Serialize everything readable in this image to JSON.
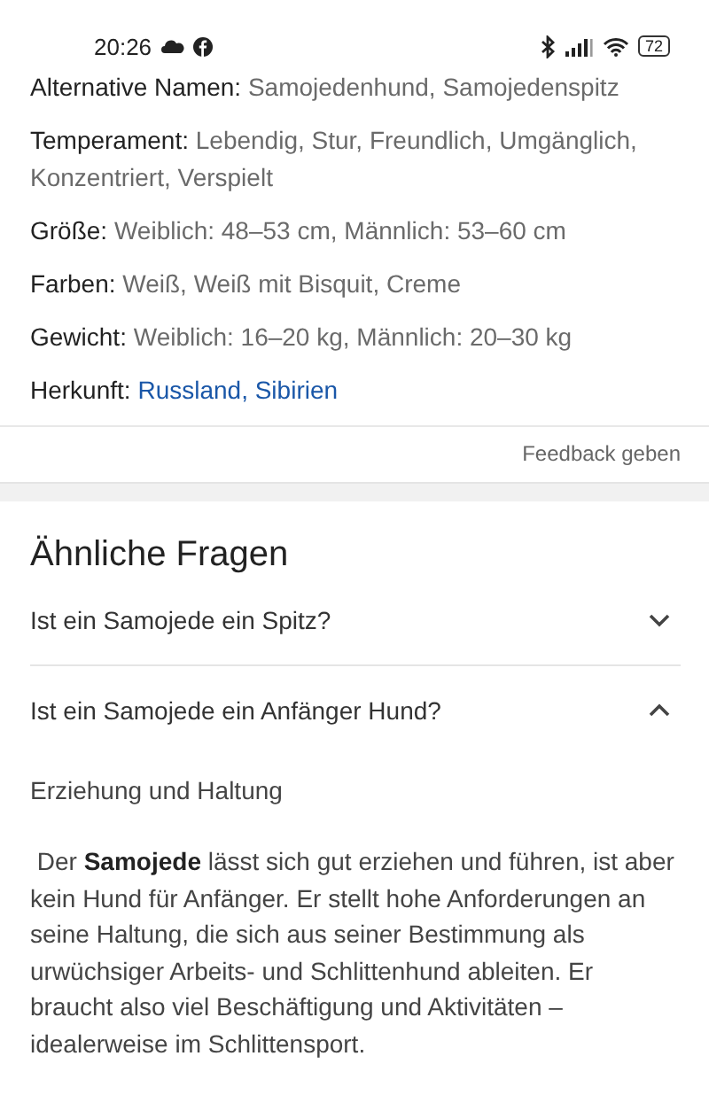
{
  "status_bar": {
    "time": "20:26",
    "battery": "72"
  },
  "facts": [
    {
      "label": "Alternative Namen:",
      "value": "Samojedenhund, Samojedenspitz",
      "kind": "text"
    },
    {
      "label": "Temperament:",
      "value": "Lebendig, Stur, Freundlich, Umgänglich, Konzentriert, Verspielt",
      "kind": "text"
    },
    {
      "label": "Größe:",
      "value": "Weiblich: 48–53 cm, Männlich: 53–60 cm",
      "kind": "text"
    },
    {
      "label": "Farben:",
      "value": "Weiß, Weiß mit Bisquit, Creme",
      "kind": "text"
    },
    {
      "label": "Gewicht:",
      "value": "Weiblich: 16–20 kg, Männlich: 20–30 kg",
      "kind": "text"
    },
    {
      "label": "Herkunft:",
      "value": "Russland, Sibirien",
      "kind": "link"
    }
  ],
  "feedback": "Feedback geben",
  "related": {
    "title": "Ähnliche Fragen",
    "questions": [
      {
        "text": "Ist ein Samojede ein Spitz?",
        "expanded": false
      },
      {
        "text": "Ist ein Samojede ein Anfänger Hund?",
        "expanded": true,
        "answer_heading": "Erziehung und Haltung",
        "answer": " Der **Samojede** lässt sich gut erziehen und führen, ist aber kein Hund für Anfänger. Er stellt hohe Anforderungen an seine Haltung, die sich aus seiner Bestimmung als urwüchsiger Arbeits- und Schlittenhund ableiten. Er braucht also viel Beschäftigung und Aktivitäten – idealerweise im Schlittensport."
      }
    ]
  }
}
